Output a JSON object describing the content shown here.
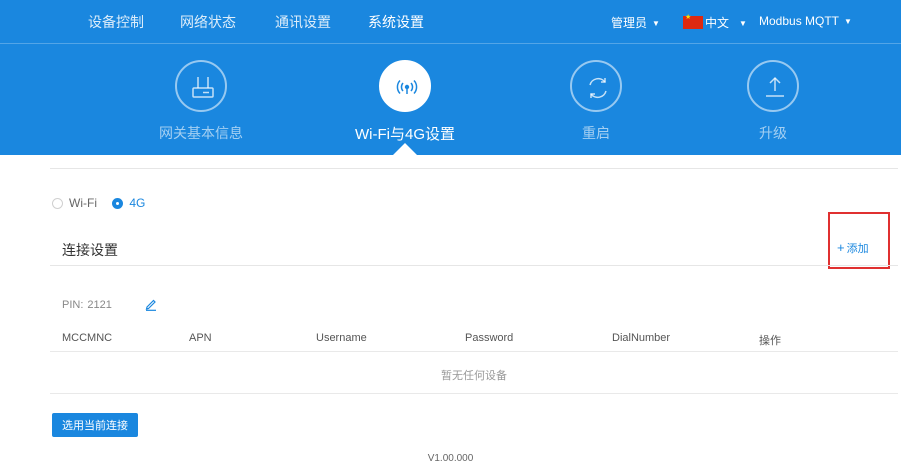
{
  "nav": {
    "items": [
      {
        "label": "设备控制"
      },
      {
        "label": "网络状态"
      },
      {
        "label": "通讯设置"
      },
      {
        "label": "系统设置"
      }
    ],
    "admin_label": "管理员",
    "language_label": "中文",
    "protocol_label": "Modbus MQTT"
  },
  "tiles": [
    {
      "label": "网关基本信息",
      "icon": "router-icon"
    },
    {
      "label": "Wi-Fi与4G设置",
      "icon": "wifi-signal-icon"
    },
    {
      "label": "重启",
      "icon": "restart-icon"
    },
    {
      "label": "升级",
      "icon": "upgrade-icon"
    }
  ],
  "network_mode": {
    "options": [
      {
        "label": "Wi-Fi",
        "checked": false
      },
      {
        "label": "4G",
        "checked": true
      }
    ]
  },
  "connection": {
    "title": "连接设置",
    "add_label": "添加",
    "add_icon": "plus-icon",
    "pin_label": "PIN:",
    "pin_value": "2121",
    "columns": [
      "MCCMNC",
      "APN",
      "Username",
      "Password",
      "DialNumber",
      "操作"
    ],
    "empty_text": "暂无任何设备",
    "select_button": "选用当前连接"
  },
  "footer": {
    "version": "V1.00.000"
  },
  "colors": {
    "header_blue": "#1a87df",
    "accent": "#1a87df",
    "highlight_red": "#e03030"
  }
}
